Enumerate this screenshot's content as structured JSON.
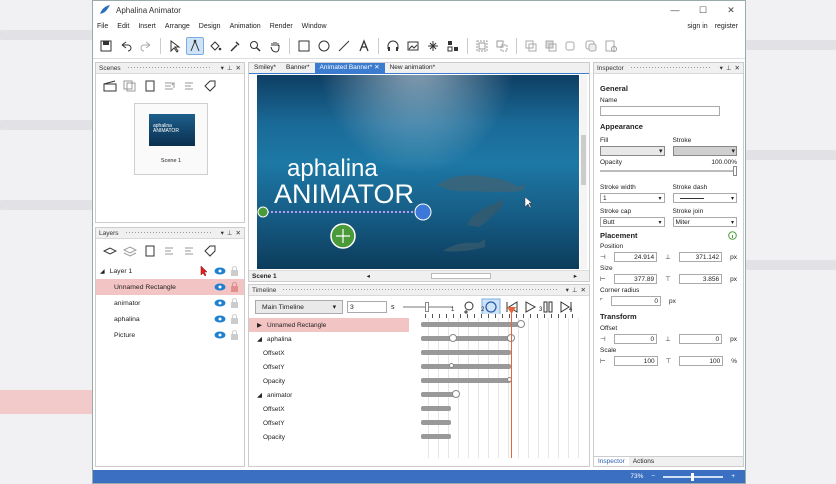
{
  "app": {
    "title": "Aphalina Animator"
  },
  "window_controls": {
    "minimize": "—",
    "maximize": "☐",
    "close": "✕"
  },
  "menu": {
    "items": [
      "File",
      "Edit",
      "Insert",
      "Arrange",
      "Design",
      "Animation",
      "Render",
      "Window"
    ],
    "sign_in": "sign in",
    "register": "register"
  },
  "colors": {
    "accent": "#3b7bd0",
    "selection": "#f3c4c4",
    "playhead": "#e4663a",
    "status_bar": "#3b6fc2"
  },
  "scenes_panel": {
    "title": "Scenes",
    "scene_label": "Scene 1",
    "thumb_text": "aphalina ANIMATOR"
  },
  "layers_panel": {
    "title": "Layers",
    "group": "Layer 1",
    "rows": [
      "Unnamed Rectangle",
      "animator",
      "aphalina",
      "Picture"
    ]
  },
  "doc_tabs": [
    "Smiley*",
    "Banner*",
    "Animated Banner*",
    "New animation*"
  ],
  "canvas": {
    "line1": "aphalina",
    "line2": "ANIMATOR",
    "scene_tab": "Scene 1"
  },
  "timeline": {
    "title": "Timeline",
    "main_timeline": "Main Timeline",
    "duration": "3",
    "unit": "s",
    "ruler": [
      "1",
      "2",
      "3",
      "4"
    ],
    "rows": [
      "Unnamed Rectangle",
      "aphalina",
      "OffsetX",
      "OffsetY",
      "Opacity",
      "animator",
      "OffsetX",
      "OffsetY",
      "Opacity"
    ]
  },
  "inspector": {
    "title": "Inspector",
    "general": "General",
    "name_label": "Name",
    "appearance": "Appearance",
    "fill_label": "Fill",
    "stroke_label": "Stroke",
    "opacity_label": "Opacity",
    "opacity_value": "100.00%",
    "stroke_width_label": "Stroke width",
    "stroke_width_value": "1",
    "stroke_dash_label": "Stroke dash",
    "stroke_cap_label": "Stroke cap",
    "stroke_cap_value": "Butt",
    "stroke_join_label": "Stroke join",
    "stroke_join_value": "Miter",
    "placement": "Placement",
    "position_label": "Position",
    "pos_x": "24.914",
    "pos_y": "371.142",
    "px": "px",
    "size_label": "Size",
    "size_w": "377.89",
    "size_h": "3.856",
    "corner_label": "Corner radius",
    "corner_value": "0",
    "transform": "Transform",
    "offset_label": "Offset",
    "offset_x": "0",
    "offset_y": "0",
    "scale_label": "Scale",
    "scale_x": "100",
    "scale_y": "100",
    "pct": "%",
    "tab_inspector": "Inspector",
    "tab_actions": "Actions"
  },
  "status": {
    "zoom": "73%"
  }
}
